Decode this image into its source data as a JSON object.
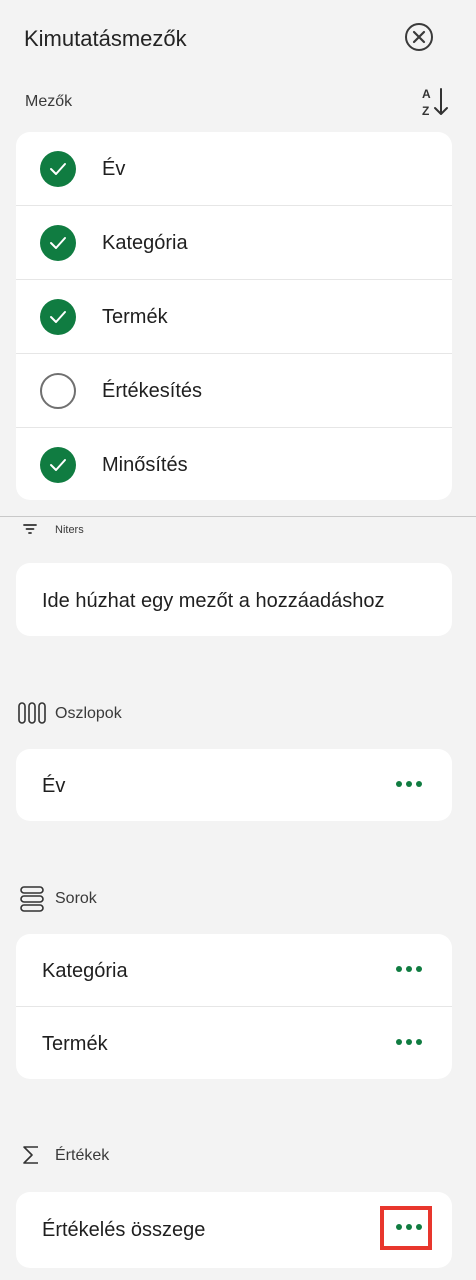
{
  "header": {
    "title": "Kimutatásmezők",
    "close_icon": "close-circle-icon"
  },
  "fields_section": {
    "label": "Mezők",
    "sort_icon": "sort-az-icon"
  },
  "fields": [
    {
      "label": "Év",
      "checked": true
    },
    {
      "label": "Kategória",
      "checked": true
    },
    {
      "label": "Termék",
      "checked": true
    },
    {
      "label": "Értékesítés",
      "checked": false
    },
    {
      "label": "Minősítés",
      "checked": true
    }
  ],
  "filters": {
    "label": "Niters",
    "placeholder": "Ide húzhat egy mezőt a hozzáadáshoz"
  },
  "columns": {
    "label": "Oszlopok",
    "items": [
      "Év"
    ]
  },
  "rows": {
    "label": "Sorok",
    "items": [
      "Kategória",
      "Termék"
    ]
  },
  "values": {
    "label": "Értékek",
    "items": [
      "Értékelés összege"
    ]
  },
  "colors": {
    "accent": "#107c41",
    "highlight": "#e8362d",
    "background": "#f3f3f3"
  }
}
